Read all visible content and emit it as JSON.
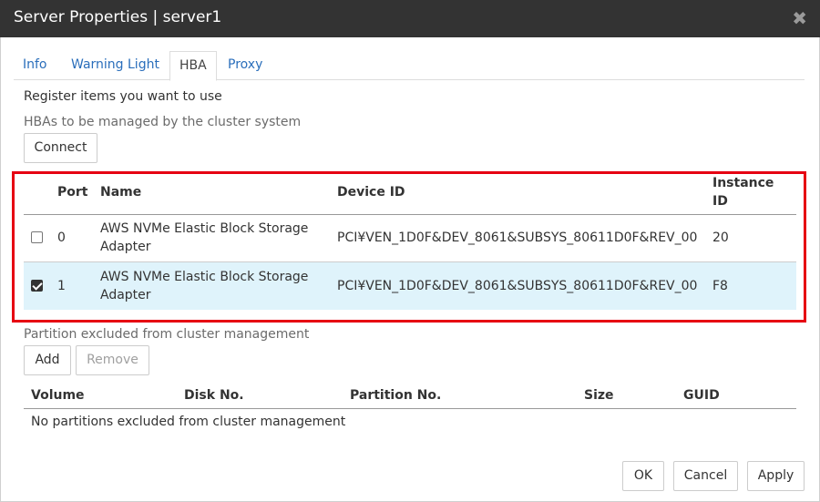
{
  "window": {
    "title": "Server Properties | server1",
    "close_glyph": "✖"
  },
  "tabs": [
    {
      "label": "Info"
    },
    {
      "label": "Warning Light"
    },
    {
      "label": "HBA"
    },
    {
      "label": "Proxy"
    }
  ],
  "active_tab": "HBA",
  "register_label": "Register items you want to use",
  "hba_section": {
    "label": "HBAs to be managed by the cluster system",
    "connect_label": "Connect",
    "columns": {
      "port": "Port",
      "name": "Name",
      "device_id": "Device ID",
      "instance_id_line1": "Instance",
      "instance_id_line2": "ID"
    },
    "rows": [
      {
        "checked": false,
        "port": "0",
        "name_line1": "AWS NVMe Elastic Block Storage",
        "name_line2": "Adapter",
        "device_id": "PCI¥VEN_1D0F&DEV_8061&SUBSYS_80611D0F&REV_00",
        "instance_id": "20"
      },
      {
        "checked": true,
        "port": "1",
        "name_line1": "AWS NVMe Elastic Block Storage",
        "name_line2": "Adapter",
        "device_id": "PCI¥VEN_1D0F&DEV_8061&SUBSYS_80611D0F&REV_00",
        "instance_id": "F8"
      }
    ]
  },
  "partition_section": {
    "label": "Partition excluded from cluster management",
    "add_label": "Add",
    "remove_label": "Remove",
    "columns": {
      "volume": "Volume",
      "disk_no": "Disk No.",
      "partition_no": "Partition No.",
      "size": "Size",
      "guid": "GUID"
    },
    "empty_message": "No partitions excluded from cluster management"
  },
  "footer": {
    "ok_label": "OK",
    "cancel_label": "Cancel",
    "apply_label": "Apply"
  },
  "colors": {
    "titlebar": "#333333",
    "tab_link": "#2a6ebb",
    "highlight_border": "#e60012",
    "selected_row": "#dff3fb"
  }
}
